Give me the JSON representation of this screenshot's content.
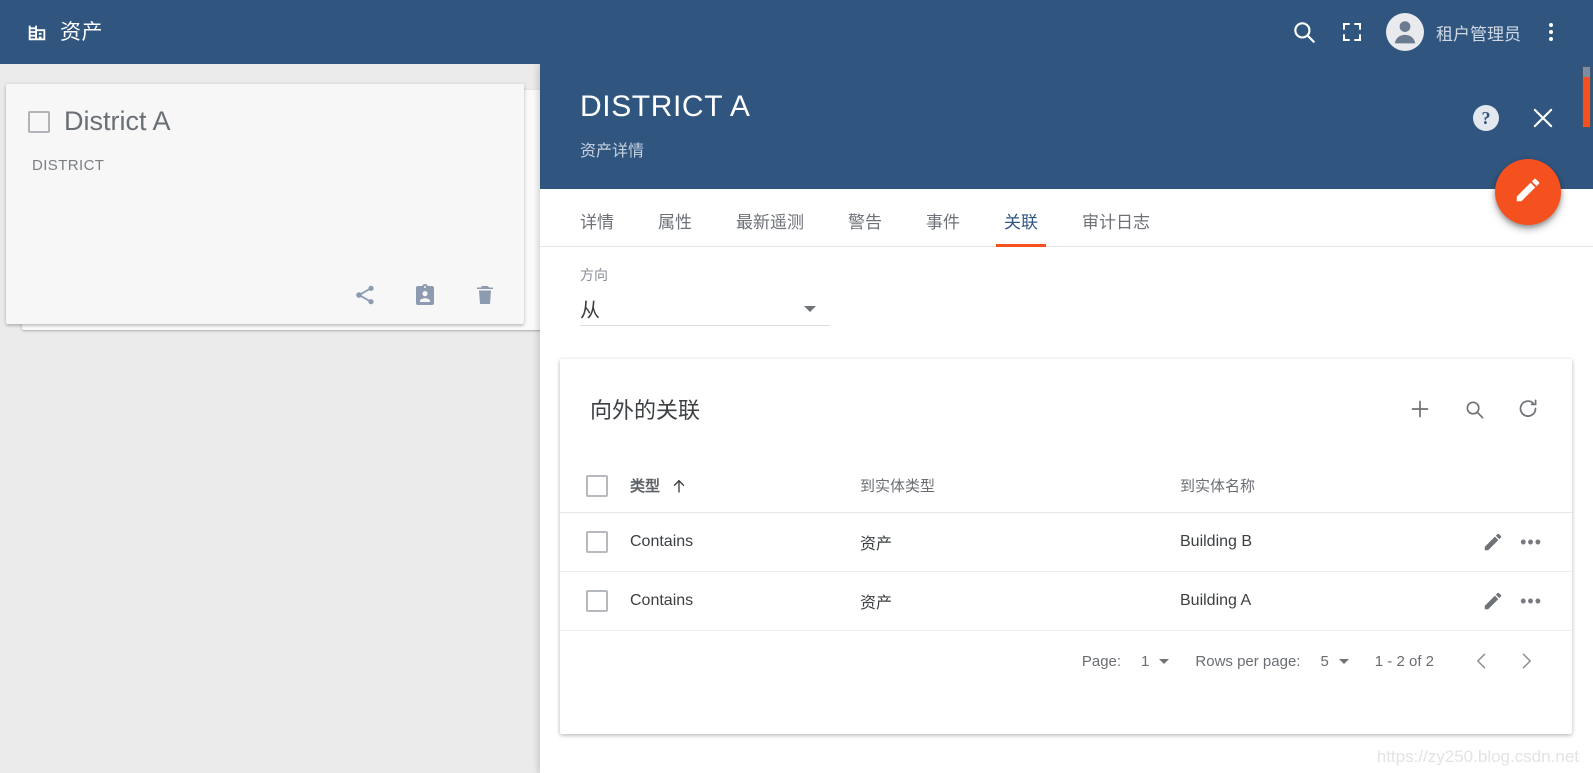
{
  "appbar": {
    "icon": "building-icon",
    "title": "资产",
    "search_icon": "search-icon",
    "fullscreen_icon": "fullscreen-icon",
    "avatar_icon": "account-circle-icon",
    "user_name": "租户管理员",
    "menu_icon": "more-vert-icon"
  },
  "entity_card": {
    "checkbox_checked": false,
    "title": "District A",
    "type": "DISTRICT",
    "actions": [
      {
        "name": "share-icon",
        "label": "分享"
      },
      {
        "name": "assignee-badge-icon",
        "label": "分配用户"
      },
      {
        "name": "trash-icon",
        "label": "删除"
      }
    ]
  },
  "detail": {
    "title": "DISTRICT A",
    "subtitle": "资产详情",
    "help_icon": "help-icon",
    "help_glyph": "?",
    "close_icon": "close-icon",
    "close_glyph": "✕",
    "fab_icon": "pencil-icon",
    "tabs": [
      {
        "label": "详情",
        "active": false
      },
      {
        "label": "属性",
        "active": false
      },
      {
        "label": "最新遥测",
        "active": false
      },
      {
        "label": "警告",
        "active": false
      },
      {
        "label": "事件",
        "active": false
      },
      {
        "label": "关联",
        "active": true
      },
      {
        "label": "审计日志",
        "active": false
      }
    ],
    "direction": {
      "label": "方向",
      "value": "从",
      "caret_icon": "chevron-down-icon"
    }
  },
  "table_card": {
    "title": "向外的关联",
    "toolbar": [
      {
        "name": "add-icon",
        "glyph": "+"
      },
      {
        "name": "search-icon",
        "glyph": ""
      },
      {
        "name": "refresh-icon",
        "glyph": ""
      }
    ],
    "columns": [
      {
        "key": "type",
        "label": "类型",
        "sorted": true,
        "sort_dir": "asc"
      },
      {
        "key": "to_entity_type",
        "label": "到实体类型",
        "sorted": false
      },
      {
        "key": "to_entity_name",
        "label": "到实体名称",
        "sorted": false
      }
    ],
    "sort_icon": "arrow-up-icon",
    "rows": [
      {
        "type": "Contains",
        "to_entity_type": "资产",
        "to_entity_name": "Building B"
      },
      {
        "type": "Contains",
        "to_entity_type": "资产",
        "to_entity_name": "Building A"
      }
    ],
    "row_actions": [
      {
        "name": "edit-pencil-icon"
      },
      {
        "name": "more-horiz-icon",
        "glyph": "•••"
      }
    ],
    "footer": {
      "page_label": "Page:",
      "page_value": "1",
      "rows_per_page_label": "Rows per page:",
      "rows_per_page_value": "5",
      "range": "1 - 2 of 2",
      "prev_icon": "chevron-left-icon",
      "prev_glyph": "‹",
      "next_icon": "chevron-right-icon",
      "next_glyph": "›"
    }
  },
  "watermark": "https://zy250.blog.csdn.net",
  "colors": {
    "primary": "#305680",
    "accent": "#f4511e",
    "panel_bg": "#ebebeb",
    "card_bg": "#f7f7f7",
    "text": "#3c4043"
  }
}
